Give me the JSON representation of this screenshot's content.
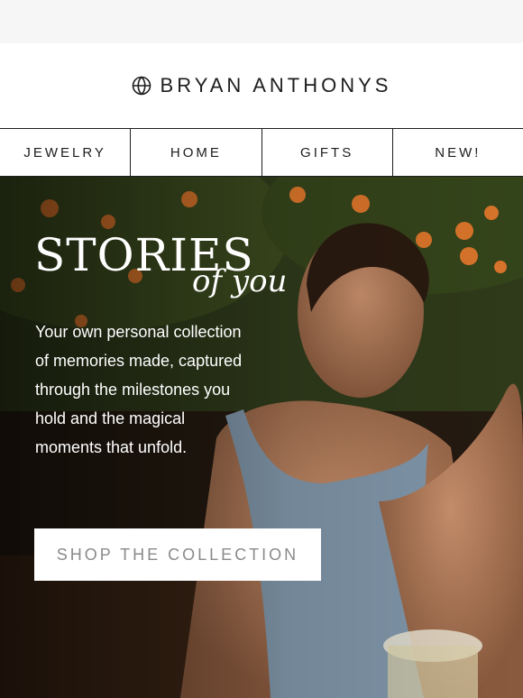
{
  "brand": {
    "name": "BRYAN ANTHONYS",
    "logo_icon": "globe-icon"
  },
  "nav": {
    "items": [
      {
        "label": "JEWELRY"
      },
      {
        "label": "HOME"
      },
      {
        "label": "GIFTS"
      },
      {
        "label": "NEW!"
      }
    ]
  },
  "hero": {
    "headline": "STORIES",
    "headline_script": "of you",
    "body": "Your own personal collection of memories made, captured through the milestones you hold and the magical moments that unfold.",
    "cta_label": "SHOP THE COLLECTION"
  },
  "colors": {
    "text_dark": "#1d1d1d",
    "cta_text": "#8a8a8a",
    "topbar_bg": "#f6f6f6"
  }
}
